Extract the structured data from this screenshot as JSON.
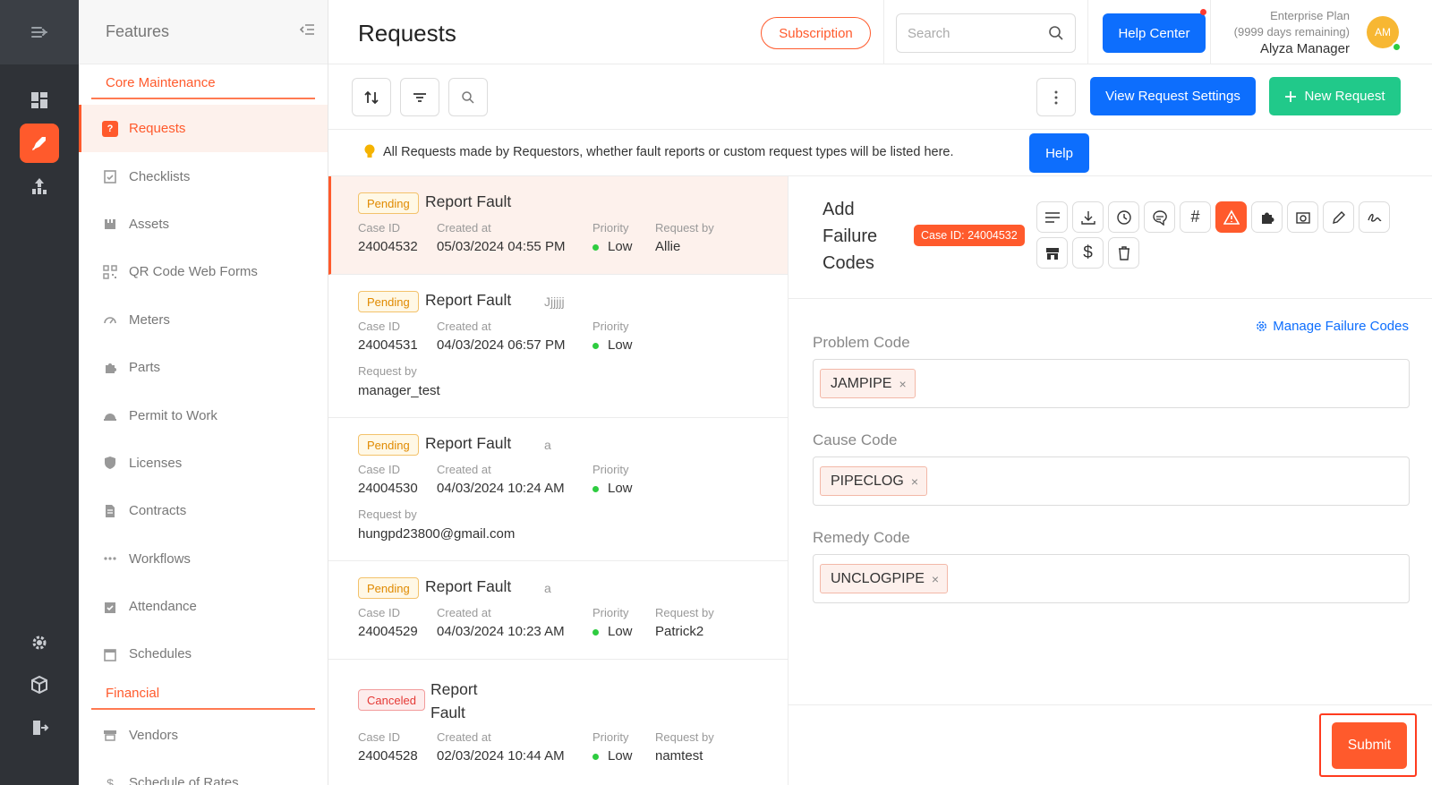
{
  "features": {
    "title": "Features",
    "sections": [
      {
        "title": "Core Maintenance",
        "items": [
          {
            "label": "Requests",
            "icon": "question-square-icon",
            "active": true
          },
          {
            "label": "Checklists",
            "icon": "clipboard-icon"
          },
          {
            "label": "Assets",
            "icon": "assets-icon"
          },
          {
            "label": "QR Code Web Forms",
            "icon": "qr-code-icon"
          },
          {
            "label": "Meters",
            "icon": "gauge-icon"
          },
          {
            "label": "Parts",
            "icon": "puzzle-icon"
          },
          {
            "label": "Permit to Work",
            "icon": "hard-hat-icon"
          },
          {
            "label": "Licenses",
            "icon": "shield-icon"
          },
          {
            "label": "Contracts",
            "icon": "contract-icon"
          },
          {
            "label": "Workflows",
            "icon": "workflow-icon"
          },
          {
            "label": "Attendance",
            "icon": "check-calendar-icon"
          },
          {
            "label": "Schedules",
            "icon": "calendar-icon"
          }
        ]
      },
      {
        "title": "Financial",
        "items": [
          {
            "label": "Vendors",
            "icon": "store-icon"
          },
          {
            "label": "Schedule of Rates",
            "icon": "dollar-icon"
          }
        ]
      }
    ]
  },
  "header": {
    "title": "Requests",
    "subscription_label": "Subscription",
    "search_placeholder": "Search",
    "help_center_label": "Help Center",
    "plan_name": "Enterprise Plan",
    "plan_remaining": "(9999 days remaining)",
    "user_name": "Alyza Manager",
    "avatar_initials": "AM"
  },
  "toolbar": {
    "view_settings_label": "View Request Settings",
    "new_request_label": "New Request"
  },
  "info": {
    "text": "All Requests made by Requestors, whether fault reports or custom request types will be listed here.",
    "help_label": "Help"
  },
  "list_labels": {
    "case_id": "Case ID",
    "created_at": "Created at",
    "priority": "Priority",
    "request_by": "Request by"
  },
  "requests": [
    {
      "status": "Pending",
      "title": "Report Fault",
      "subtitle": "",
      "case_id": "24004532",
      "created_at": "05/03/2024 04:55 PM",
      "priority": "Low",
      "request_by": "Allie"
    },
    {
      "status": "Pending",
      "title": "Report Fault",
      "subtitle": "Jjjjjj",
      "case_id": "24004531",
      "created_at": "04/03/2024 06:57 PM",
      "priority": "Low",
      "request_by": "manager_test"
    },
    {
      "status": "Pending",
      "title": "Report Fault",
      "subtitle": "a",
      "case_id": "24004530",
      "created_at": "04/03/2024 10:24 AM",
      "priority": "Low",
      "request_by": "hungpd23800@gmail.com"
    },
    {
      "status": "Pending",
      "title": "Report Fault",
      "subtitle": "a",
      "case_id": "24004529",
      "created_at": "04/03/2024 10:23 AM",
      "priority": "Low",
      "request_by": "Patrick2"
    },
    {
      "status": "Canceled",
      "title": "Report Fault",
      "subtitle": "",
      "case_id": "24004528",
      "created_at": "02/03/2024 10:44 AM",
      "priority": "Low",
      "request_by": "namtest"
    }
  ],
  "detail": {
    "title_line1": "Add",
    "title_line2": "Failure",
    "title_line3": "Codes",
    "case_pill": "Case ID: 24004532",
    "manage_label": "Manage Failure Codes",
    "problem_label": "Problem Code",
    "problem_value": "JAMPIPE",
    "cause_label": "Cause Code",
    "cause_value": "PIPECLOG",
    "remedy_label": "Remedy Code",
    "remedy_value": "UNCLOGPIPE",
    "submit_label": "Submit"
  },
  "colors": {
    "accent": "#ff5a2c",
    "primary_blue": "#0d6efd",
    "success_green": "#21c98a",
    "rail_dark": "#2f3237"
  }
}
